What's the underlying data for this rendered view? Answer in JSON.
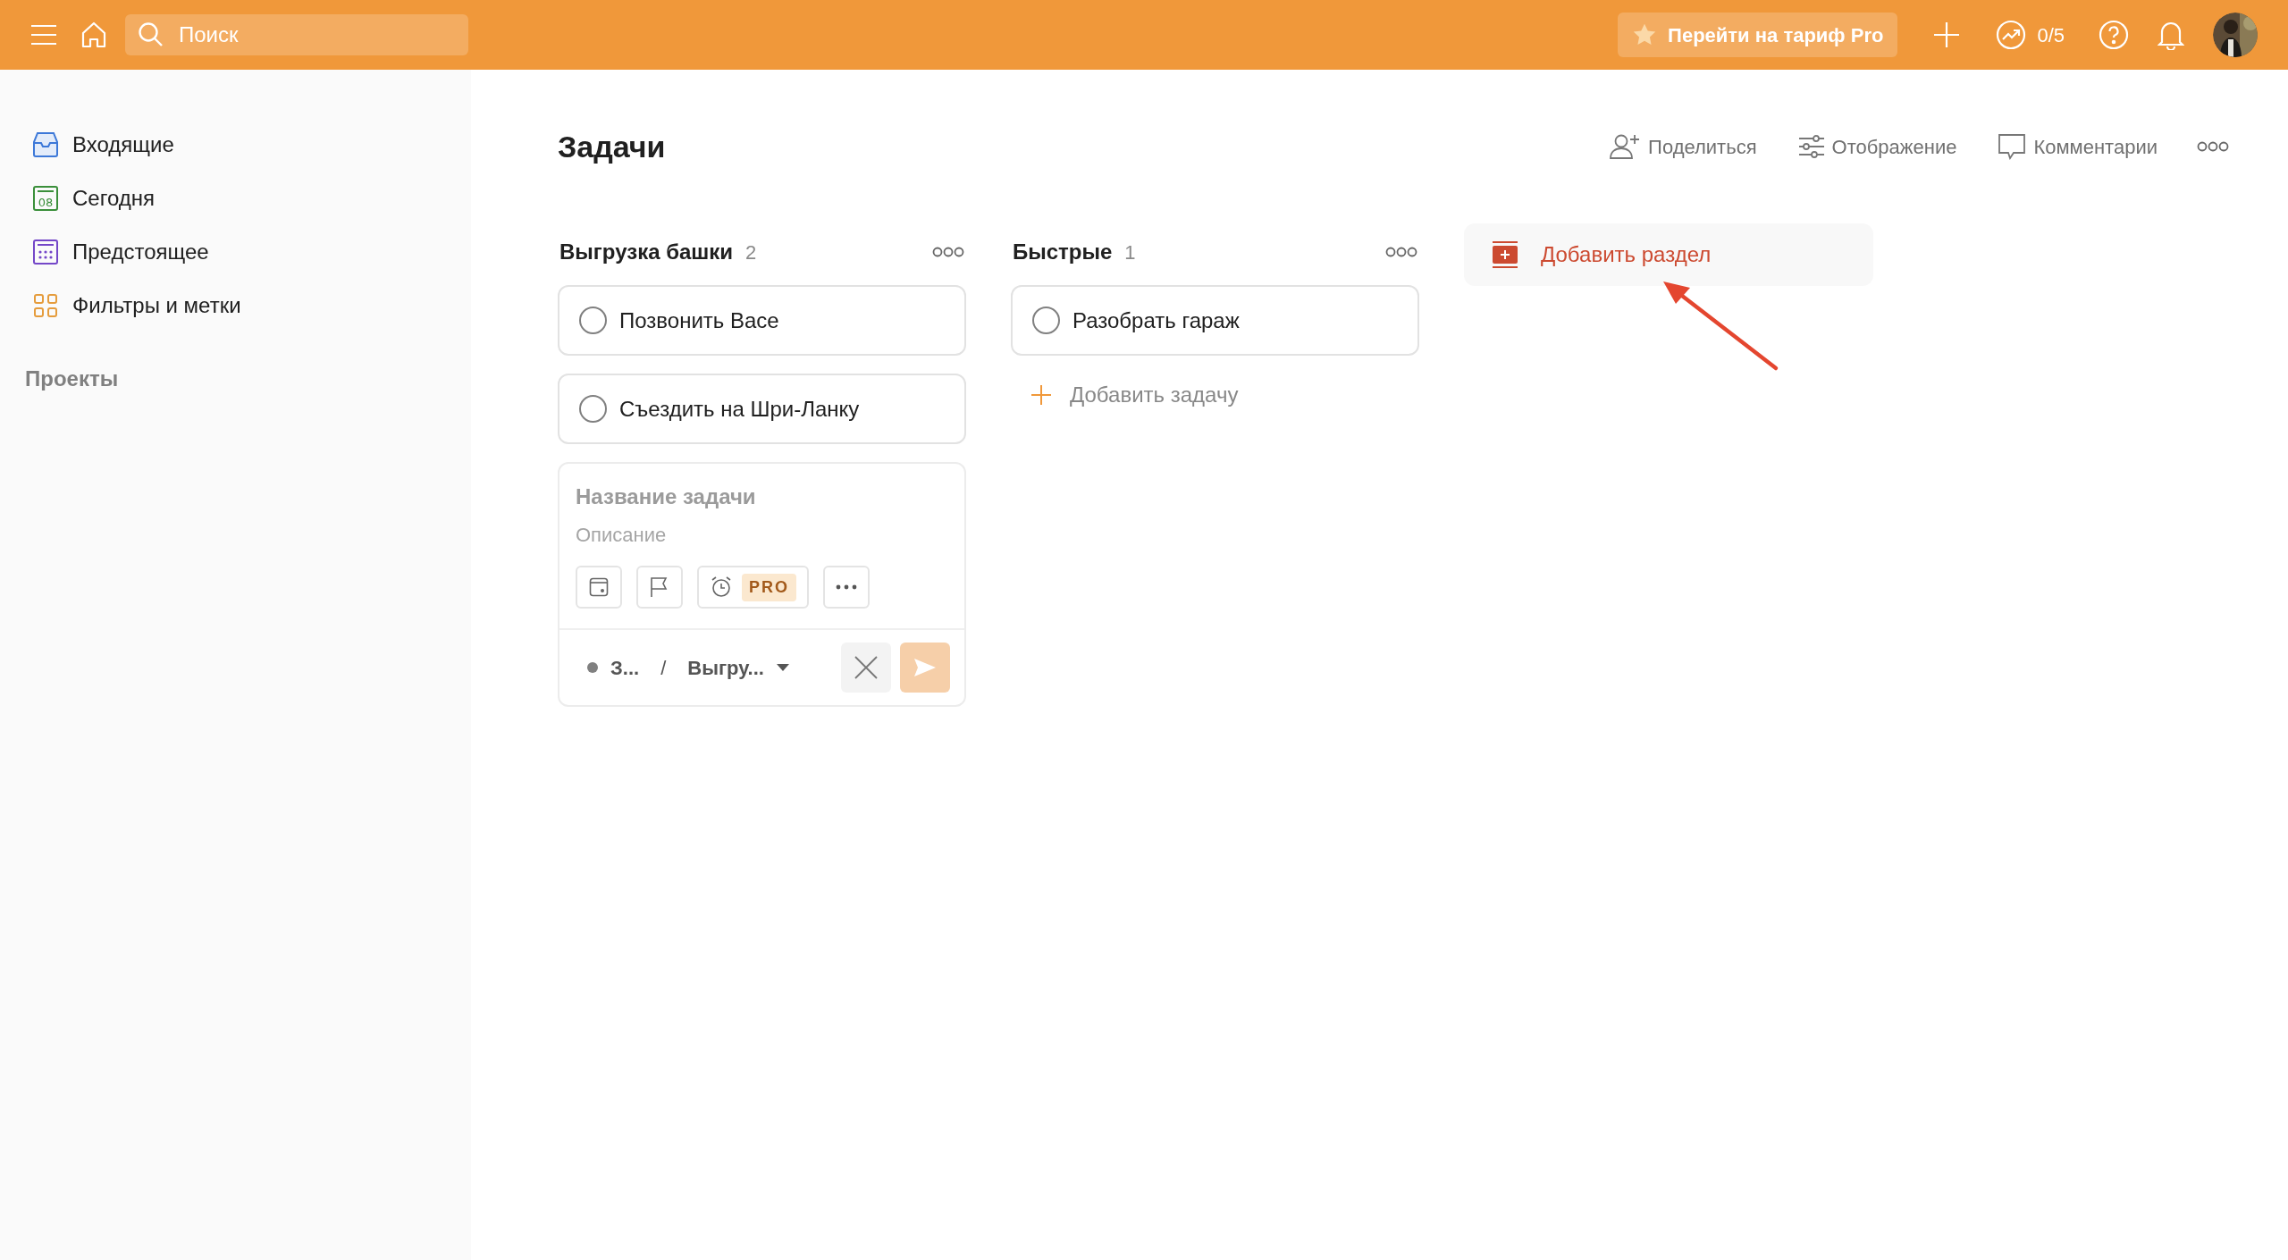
{
  "top_bar": {
    "search": {
      "placeholder": "Поиск"
    },
    "upgrade_button": "Перейти на тариф Pro",
    "karma": "0/5"
  },
  "sidebar": {
    "items": [
      {
        "label": "Входящие",
        "kind": "inbox"
      },
      {
        "label": "Сегодня",
        "kind": "today",
        "icon_text": "08"
      },
      {
        "label": "Предстоящее",
        "kind": "upcoming"
      },
      {
        "label": "Фильтры и метки",
        "kind": "filters"
      }
    ],
    "projects_heading": "Проекты"
  },
  "project": {
    "title": "Задачи",
    "actions": [
      {
        "label": "Поделиться",
        "kind": "share"
      },
      {
        "label": "Отображение",
        "kind": "view"
      },
      {
        "label": "Комментарии",
        "kind": "comments"
      }
    ]
  },
  "sections": [
    {
      "name": "Выгрузка башки",
      "count": "2",
      "tasks": [
        {
          "title": "Позвонить Васе",
          "completed": false
        },
        {
          "title": "Съездить на Шри-Ланку",
          "completed": false
        }
      ],
      "editor": {
        "title_placeholder": "Название задачи",
        "description_placeholder": "Описание",
        "pro_badge": "PRO",
        "project": "З...",
        "separator": "/",
        "section": "Выгру...",
        "submit_disabled": true
      }
    },
    {
      "name": "Быстрые",
      "count": "1",
      "tasks": [
        {
          "title": "Разобрать гараж",
          "completed": false
        }
      ],
      "add_task": "Добавить задачу"
    }
  ],
  "add_section": "Добавить раздел"
}
